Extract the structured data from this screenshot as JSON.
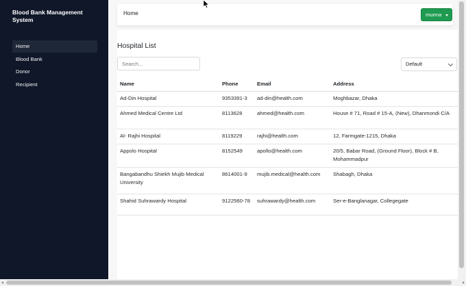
{
  "sidebar": {
    "brand": "Blood Bank Management System",
    "items": [
      {
        "label": "Home",
        "active": true
      },
      {
        "label": "Blood Bank",
        "active": false
      },
      {
        "label": "Donor",
        "active": false
      },
      {
        "label": "Recipient",
        "active": false
      }
    ]
  },
  "topbar": {
    "title": "Home",
    "user_label": "munna",
    "user_button_color": "#1e9b50"
  },
  "main": {
    "page_title": "Hospital List",
    "search": {
      "placeholder": "Search...",
      "value": ""
    },
    "sort_select": {
      "selected": "Default"
    },
    "table": {
      "headers": [
        "Name",
        "Phone",
        "Email",
        "Address"
      ],
      "rows": [
        {
          "name": "Ad-Din Hospital",
          "phone": "9353391-3",
          "email": "ad-din@health.com",
          "address": "Moghbazar, Dhaka"
        },
        {
          "name": "Ahmed Medical Centre Ltd",
          "phone": "8113628",
          "email": "ahmed@health.com",
          "address": "House # 71, Road # 15-A, (New), Dhanmondi C/A"
        },
        {
          "name": "Al- Rajhi Hospital",
          "phone": "8119229",
          "email": "rajhi@health.com",
          "address": "12, Farmgate-1215, Dhaka"
        },
        {
          "name": "Appolo Hospital",
          "phone": "8152549",
          "email": "apollo@health.com",
          "address": "20/5, Babar Road, (Ground Floor), Block # B, Mohammadpur"
        },
        {
          "name": "Bangabandhu Shiekh Mujib Medical University",
          "phone": "8614001-9",
          "email": "mujib.medical@health.com",
          "address": "Shabagh, Dhaka"
        },
        {
          "name": "Shahid Suhrawardy Hospital",
          "phone": "9122560-78",
          "email": "suhrawardy@health.com",
          "address": "Ser-e-Banglanagar, Collegegate"
        }
      ]
    }
  },
  "colors": {
    "sidebar_bg": "#0f1729",
    "accent_green": "#1e9b50"
  }
}
